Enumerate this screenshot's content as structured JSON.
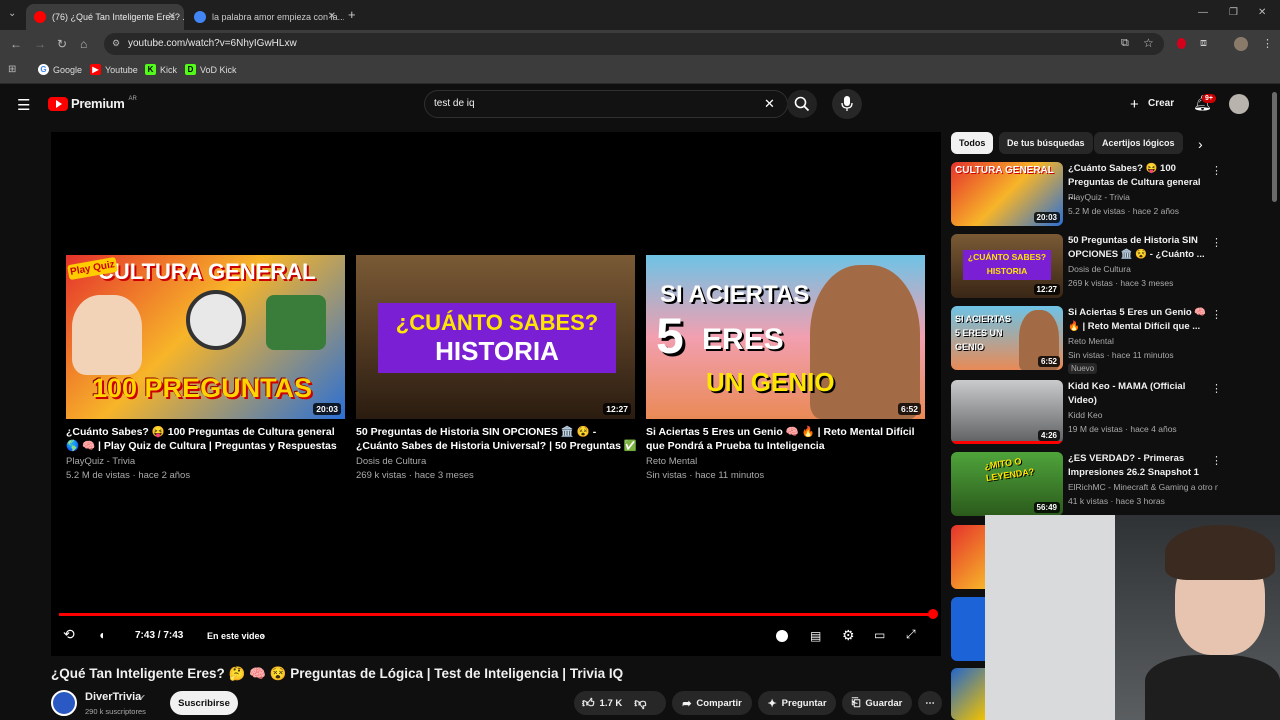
{
  "browser": {
    "tabs": [
      {
        "title": "(76) ¿Qué Tan Inteligente Eres? ..."
      },
      {
        "title": "la palabra amor empieza con la..."
      }
    ],
    "url": "youtube.com/watch?v=6NhyIGwHLxw",
    "bookmarks": [
      {
        "label": "Google"
      },
      {
        "label": "Youtube"
      },
      {
        "label": "Kick"
      },
      {
        "label": "VoD Kick"
      }
    ],
    "notification_count": "9+"
  },
  "youtube": {
    "logo": "Premium",
    "region": "AR",
    "search_value": "test de iq",
    "create_label": "Crear",
    "notif_badge": "9+"
  },
  "player": {
    "time": "7:43 / 7:43",
    "chapter": "En este video",
    "progress": 1.0,
    "end_cards": [
      {
        "thumb_text": [
          "CULTURA GENERAL",
          "100 PREGUNTAS"
        ],
        "thumb_badge": "Play Quiz",
        "duration": "20:03",
        "title": "¿Cuánto Sabes? 😝 100 Preguntas de Cultura general 🌎 🧠 | Play Quiz de Cultura | Preguntas y Respuestas",
        "channel": "PlayQuiz - Trivia",
        "meta": "5.2 M de vistas · hace 2 años"
      },
      {
        "thumb_text": [
          "¿CUÁNTO SABES?",
          "HISTORIA"
        ],
        "duration": "12:27",
        "title": "50 Preguntas de Historia SIN OPCIONES 🏛️ 😵 - ¿Cuánto Sabes de Historia Universal? | 50 Preguntas ✅",
        "channel": "Dosis de Cultura",
        "meta": "269 k vistas · hace 3 meses"
      },
      {
        "thumb_text": [
          "SI ACIERTAS",
          "5",
          "ERES",
          "UN GENIO"
        ],
        "duration": "6:52",
        "title": "Si Aciertas 5 Eres un Genio 🧠 🔥 | Reto Mental Difícil que Pondrá a Prueba tu Inteligencia",
        "channel": "Reto Mental",
        "meta": "Sin vistas · hace 11 minutos"
      }
    ]
  },
  "video": {
    "title": "¿Qué Tan Inteligente Eres? 🤔 🧠 😵 Preguntas de Lógica | Test de Inteligencia | Trivia IQ",
    "channel": "DiverTrivia",
    "subscribers": "290 k suscriptores",
    "subscribe_label": "Suscribirse",
    "likes": "1.7 K",
    "share_label": "Compartir",
    "ask_label": "Preguntar",
    "save_label": "Guardar"
  },
  "sidebar": {
    "chips": [
      {
        "label": "Todos"
      },
      {
        "label": "De tus búsquedas"
      },
      {
        "label": "Acertijos lógicos"
      }
    ],
    "items": [
      {
        "title": "¿Cuánto Sabes? 😝 100 Preguntas de Cultura general ...",
        "channel": "PlayQuiz - Trivia",
        "meta": "5.2 M de vistas · hace 2 años",
        "duration": "20:03",
        "thumb_text": "CULTURA GENERAL"
      },
      {
        "title": "50 Preguntas de Historia SIN OPCIONES 🏛️ 😵 - ¿Cuánto ...",
        "channel": "Dosis de Cultura",
        "meta": "269 k vistas · hace 3 meses",
        "duration": "12:27",
        "thumb_text": "¿CUÁNTO SABES? HISTORIA"
      },
      {
        "title": "Si Aciertas 5 Eres un Genio 🧠 🔥 | Reto Mental Difícil que ...",
        "channel": "Reto Mental",
        "meta": "Sin vistas · hace 11 minutos",
        "duration": "6:52",
        "badge": "Nuevo",
        "thumb_text": "SI ACIERTAS 5 ERES UN GENIO"
      },
      {
        "title": "Kidd Keo - MAMA (Official Video)",
        "channel": "Kidd Keo",
        "meta": "19 M de vistas · hace 4 años",
        "duration": "4:26"
      },
      {
        "title": "¿ES VERDAD? - Primeras Impresiones 26.2 Snapshot 1",
        "channel": "ElRichMC - Minecraft & Gaming a otro ni...",
        "meta": "41 k vistas · hace 3 horas",
        "duration": "56:49",
        "thumb_text": "¿MITO O LEYENDA?"
      }
    ]
  }
}
